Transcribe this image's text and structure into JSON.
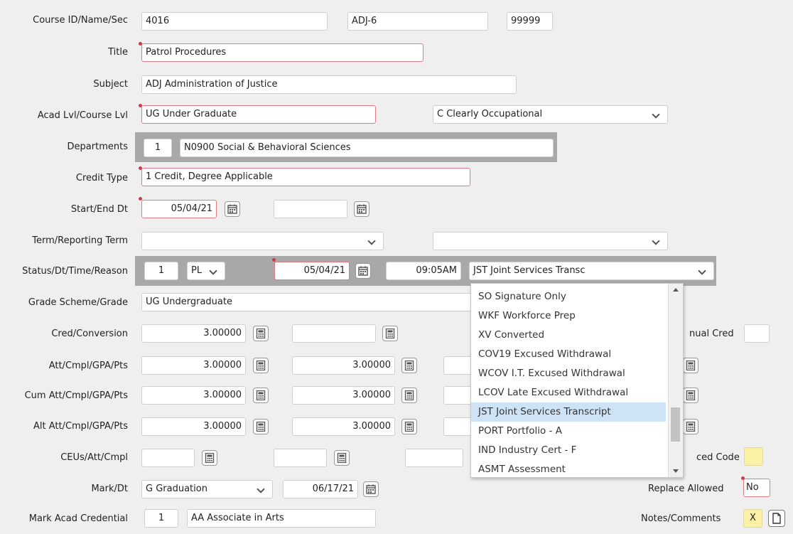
{
  "labels": {
    "course": "Course ID/Name/Sec",
    "title": "Title",
    "subject": "Subject",
    "acad_lvl": "Acad Lvl/Course Lvl",
    "departments": "Departments",
    "credit_type": "Credit Type",
    "start_end": "Start/End Dt",
    "term": "Term/Reporting Term",
    "status": "Status/Dt/Time/Reason",
    "grade_scheme": "Grade Scheme/Grade",
    "cred_conv": "Cred/Conversion",
    "annual_cred": "nual Cred",
    "att": "Att/Cmpl/GPA/Pts",
    "cum": "Cum Att/Cmpl/GPA/Pts",
    "alt": "Alt Att/Cmpl/GPA/Pts",
    "ceus": "CEUs/Att/Cmpl",
    "ced_code": "ced Code",
    "mark": "Mark/Dt",
    "replace": "Replace Allowed",
    "mark_acad": "Mark Acad Credential",
    "notes": "Notes/Comments"
  },
  "course": {
    "id": "4016",
    "name": "ADJ-6",
    "section": "99999"
  },
  "title": "Patrol Procedures",
  "subject": "ADJ  Administration of Justice",
  "acad_level": "UG Under Graduate",
  "course_level": "C Clearly Occupational",
  "department": {
    "num": "1",
    "value": "N0900 Social & Behavioral Sciences"
  },
  "credit_type": "1 Credit, Degree Applicable",
  "start_date": "05/04/21",
  "end_date": "",
  "term": "",
  "reporting_term": "",
  "status": {
    "num": "1",
    "code": "PL",
    "date": "05/04/21",
    "time": "09:05AM",
    "reason": "JST Joint Services Transc"
  },
  "grade_scheme": "UG Undergraduate",
  "cred_conversion": {
    "cred": "3.00000",
    "conv": ""
  },
  "att": {
    "att": "3.00000",
    "cmpl": "3.00000"
  },
  "cum": {
    "att": "3.00000",
    "cmpl": "3.00000"
  },
  "alt": {
    "att": "3.00000",
    "cmpl": "3.00000"
  },
  "mark": {
    "value": "G Graduation",
    "date": "06/17/21"
  },
  "replace_allowed": "No",
  "mark_acad": {
    "num": "1",
    "value": "AA Associate in Arts"
  },
  "notes_flag": "X",
  "dropdown": {
    "items": [
      "SO Signature Only",
      "WKF Workforce Prep",
      "XV Converted",
      "COV19 Excused Withdrawal",
      "WCOV I.T. Excused Withdrawal",
      "LCOV Late Excused Withdrawal",
      "JST Joint Services Transcript",
      "PORT Portfolio - A",
      "IND Industry Cert - F",
      "ASMT Assessment"
    ],
    "selected_index": 6
  },
  "colors": {
    "required_border": "#e07a85",
    "highlight": "#cfe3f7",
    "band": "#a8a8a8",
    "notes_yellow": "#fbf1a6"
  }
}
